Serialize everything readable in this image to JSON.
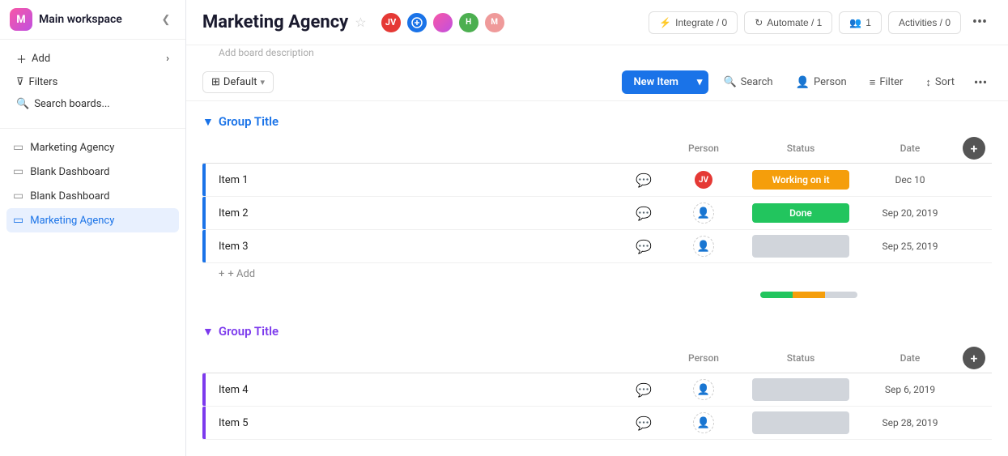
{
  "sidebar": {
    "logo_text": "M",
    "title": "Main workspace",
    "collapse_icon": "❮",
    "add_label": "Add",
    "add_chevron": "›",
    "filter_icon": "⊽",
    "filter_label": "Filters",
    "search_icon": "⌕",
    "search_label": "Search boards...",
    "nav_items": [
      {
        "id": "marketing-agency-1",
        "icon": "▭",
        "label": "Marketing Agency",
        "active": false
      },
      {
        "id": "blank-dashboard-1",
        "icon": "▭",
        "label": "Blank Dashboard",
        "active": false
      },
      {
        "id": "blank-dashboard-2",
        "icon": "▭",
        "label": "Blank Dashboard",
        "active": false
      },
      {
        "id": "marketing-agency-2",
        "icon": "▭",
        "label": "Marketing Agency",
        "active": true
      }
    ]
  },
  "header": {
    "board_title": "Marketing Agency",
    "board_description": "Add board description",
    "star_icon": "☆",
    "avatars": [
      {
        "id": "jv",
        "initials": "JV",
        "color": "#e53935"
      },
      {
        "id": "blue",
        "initials": "",
        "color": "#1a73e8",
        "type": "icon"
      },
      {
        "id": "pink",
        "initials": "",
        "color": "#c050e0",
        "type": "circle"
      },
      {
        "id": "orange",
        "initials": "",
        "color": "#ff9800",
        "type": "circle"
      },
      {
        "id": "teal",
        "initials": "",
        "color": "#00897b",
        "type": "circle"
      },
      {
        "id": "m",
        "initials": "M",
        "color": "#757575"
      }
    ],
    "integrate_label": "Integrate / 0",
    "automate_label": "Automate / 1",
    "invite_label": "1",
    "activities_label": "Activities / 0",
    "more_icon": "•••"
  },
  "toolbar": {
    "view_label": "Default",
    "view_chevron": "▾",
    "new_item_label": "New Item",
    "new_item_arrow": "▾",
    "search_label": "Search",
    "person_label": "Person",
    "filter_label": "Filter",
    "sort_label": "Sort",
    "more_icon": "•••"
  },
  "group1": {
    "title": "Group Title",
    "chevron": "▼",
    "col_person": "Person",
    "col_status": "Status",
    "col_date": "Date",
    "items": [
      {
        "id": "item1",
        "name": "Item 1",
        "person": "JV",
        "person_color": "#e53935",
        "status": "Working on it",
        "status_type": "working",
        "date": "Dec 10"
      },
      {
        "id": "item2",
        "name": "Item 2",
        "person": "",
        "status": "Done",
        "status_type": "done",
        "date": "Sep 20, 2019"
      },
      {
        "id": "item3",
        "name": "Item 3",
        "person": "",
        "status": "",
        "status_type": "empty",
        "date": "Sep 25, 2019"
      }
    ],
    "add_label": "+ Add"
  },
  "group2": {
    "title": "Group Title",
    "chevron": "▼",
    "col_person": "Person",
    "col_status": "Status",
    "col_date": "Date",
    "items": [
      {
        "id": "item4",
        "name": "Item 4",
        "person": "",
        "status": "",
        "status_type": "empty",
        "date": "Sep 6, 2019"
      },
      {
        "id": "item5",
        "name": "Item 5",
        "person": "",
        "status": "",
        "status_type": "empty",
        "date": "Sep 28, 2019"
      }
    ]
  }
}
